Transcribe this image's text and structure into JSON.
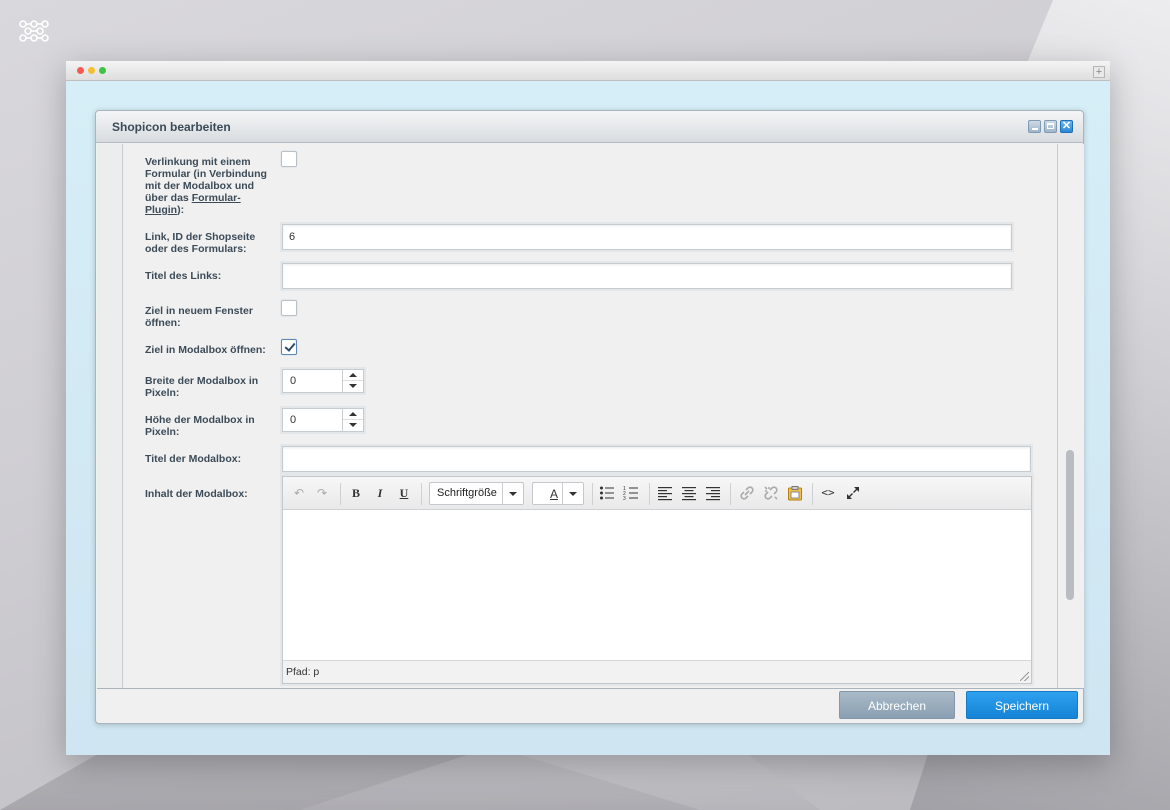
{
  "dialog": {
    "title": "Shopicon bearbeiten"
  },
  "form": {
    "link_form_label_pre": "Verlinkung mit einem Formular (in Verbindung mit der Modalbox und über das ",
    "link_form_label_link": "Formular-Plugin",
    "link_form_label_post": "):",
    "link_form_checked": false,
    "link_id_label": "Link, ID der Shopseite oder des Formulars:",
    "link_id_value": "6",
    "link_title_label": "Titel des Links:",
    "link_title_value": "",
    "new_window_label": "Ziel in neuem Fenster öffnen:",
    "new_window_checked": false,
    "modalbox_open_label": "Ziel in Modalbox öffnen:",
    "modalbox_open_checked": true,
    "modalbox_width_label": "Breite der Modalbox in Pixeln:",
    "modalbox_width_value": "0",
    "modalbox_height_label": "Höhe der Modalbox in Pixeln:",
    "modalbox_height_value": "0",
    "modalbox_title_label": "Titel der Modalbox:",
    "modalbox_title_value": "",
    "modalbox_content_label": "Inhalt der Modalbox:"
  },
  "editor": {
    "font_size_select": "Schriftgröße",
    "color_glyph": "A",
    "status_path": "Pfad: p",
    "icons": [
      "undo-icon",
      "redo-icon",
      "bold-icon",
      "italic-icon",
      "underline-icon",
      "bullet-list-icon",
      "numbered-list-icon",
      "align-left-icon",
      "align-center-icon",
      "align-right-icon",
      "link-icon",
      "unlink-icon",
      "paste-icon",
      "source-code-icon",
      "fullscreen-icon"
    ]
  },
  "footer": {
    "cancel_label": "Abbrechen",
    "save_label": "Speichern"
  },
  "colors": {
    "save_button": "#1b8fe3",
    "cancel_button": "#97abbb",
    "window_bg": "#d3eaf5"
  }
}
